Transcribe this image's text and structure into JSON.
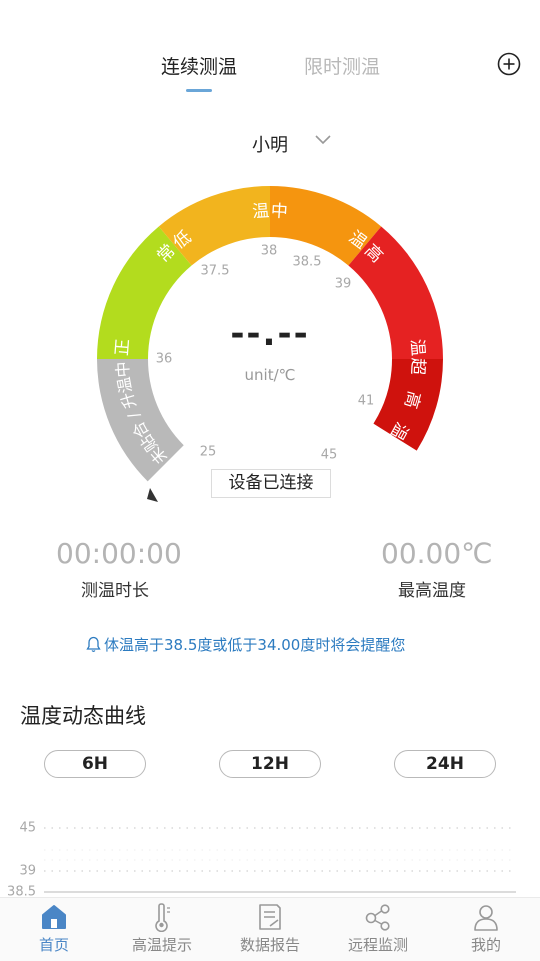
{
  "tabs": [
    {
      "label": "连续测温",
      "active": true
    },
    {
      "label": "限时测温",
      "active": false
    }
  ],
  "person": {
    "name": "小明"
  },
  "gauge": {
    "segments": [
      {
        "label": "未贴合/升温中",
        "color": "#b9b9b9"
      },
      {
        "label": "正常",
        "color": "#b3dc1e"
      },
      {
        "label": "低温",
        "color": "#f2b41e"
      },
      {
        "label": "中温",
        "color": "#f5950f"
      },
      {
        "label": "高温",
        "color": "#e52222"
      },
      {
        "label": "超高温",
        "color": "#cf120d"
      }
    ],
    "ticks": [
      "25",
      "36",
      "37.5",
      "38",
      "38.5",
      "39",
      "41",
      "45"
    ],
    "reading": "--.--",
    "unit": "unit/℃",
    "status": "设备已连接"
  },
  "stats": {
    "duration": {
      "value": "00:00:00",
      "label": "测温时长"
    },
    "max_temp": {
      "value": "00.00℃",
      "label": "最高温度"
    }
  },
  "notice": "体温高于38.5度或低于34.00度时将会提醒您",
  "curve": {
    "title": "温度动态曲线",
    "ranges": [
      "6H",
      "12H",
      "24H"
    ]
  },
  "chart_data": {
    "type": "line",
    "series": [],
    "y_ticks": [
      "45",
      "39",
      "38.5"
    ],
    "grid": true
  },
  "nav": [
    {
      "label": "首页",
      "icon": "home-icon",
      "active": true
    },
    {
      "label": "高温提示",
      "icon": "thermometer-icon",
      "active": false
    },
    {
      "label": "数据报告",
      "icon": "report-icon",
      "active": false
    },
    {
      "label": "远程监测",
      "icon": "share-nodes-icon",
      "active": false
    },
    {
      "label": "我的",
      "icon": "user-icon",
      "active": false
    }
  ],
  "colors": {
    "accent": "#4a86c6",
    "notice": "#2c7bc0"
  }
}
